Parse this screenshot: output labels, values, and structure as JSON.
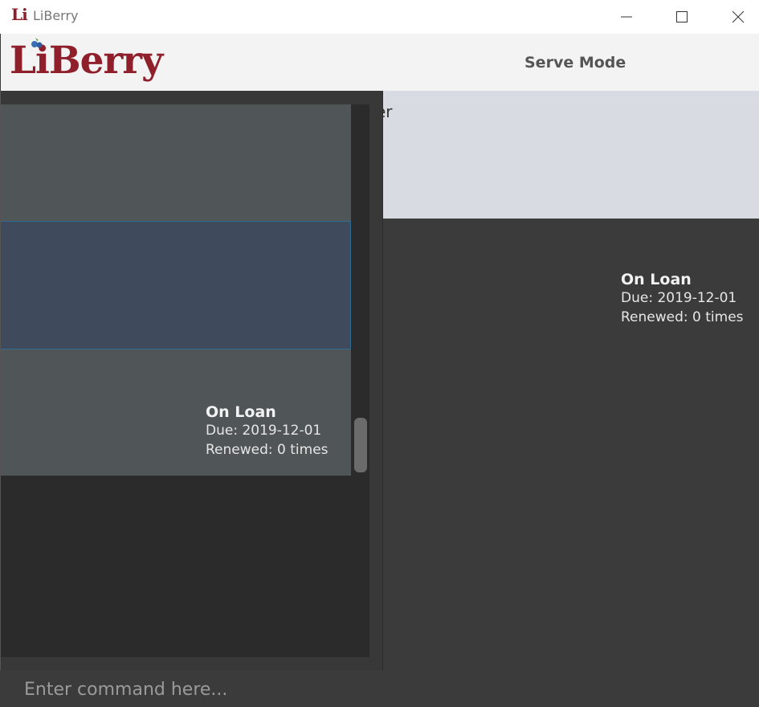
{
  "window": {
    "icon_text": "Li",
    "title": "LiBerry",
    "controls": [
      "minimize-icon",
      "maximize-icon",
      "close-icon"
    ]
  },
  "header": {
    "logo_text": "LiBerry",
    "mode_label": "Serve Mode"
  },
  "detail_panel": {
    "partial_text": "er",
    "card": {
      "status": "On Loan",
      "due": "Due: 2019-12-01",
      "renewed": "Renewed: 0 times"
    }
  },
  "list": {
    "items": [
      {
        "status": "",
        "due": "",
        "renewed": ""
      },
      {
        "status": "",
        "due": "",
        "renewed": "",
        "selected": true
      },
      {
        "status": "On Loan",
        "due": "Due: 2019-12-01",
        "renewed": "Renewed: 0 times"
      }
    ]
  },
  "command_box": {
    "placeholder": "Enter command here..."
  },
  "colors": {
    "brand": "#8e1f2b",
    "background": "#3b3b3c",
    "cell": "#505558",
    "cell_selected": "#3f4b5c",
    "detail_bg": "#d9dbe3"
  }
}
